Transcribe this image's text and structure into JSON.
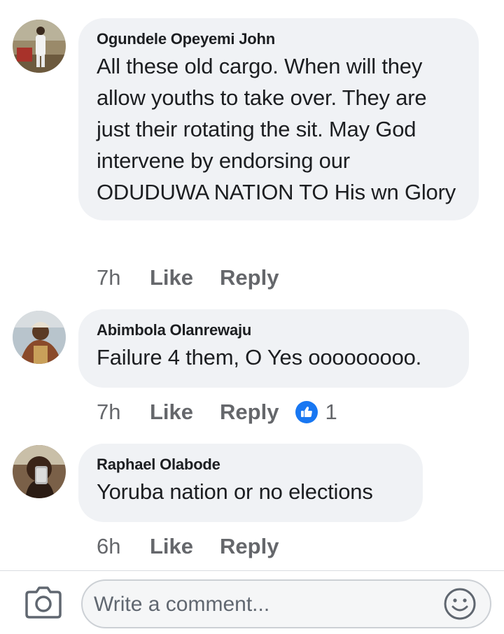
{
  "comments": [
    {
      "author": "Ogundele Opeyemi John",
      "text": "All these old cargo. When will they allow youths to take over. They are just their rotating the sit. May God intervene by endorsing our ODUDUWA NATION TO His wn Glory",
      "time": "7h",
      "like_label": "Like",
      "reply_label": "Reply"
    },
    {
      "author": "Abimbola Olanrewaju",
      "text": "Failure 4 them, O Yes ooooooooo.",
      "time": "7h",
      "like_label": "Like",
      "reply_label": "Reply",
      "reaction_count": "1"
    },
    {
      "author": "Raphael Olabode",
      "text": "Yoruba nation or no elections",
      "time": "6h",
      "like_label": "Like",
      "reply_label": "Reply"
    }
  ],
  "composer": {
    "placeholder": "Write a comment...",
    "camera_icon": "camera-icon",
    "emoji_icon": "smiley-icon"
  },
  "colors": {
    "bubble": "#f0f2f5",
    "meta_text": "#65676b",
    "like_blue": "#1877f2"
  }
}
